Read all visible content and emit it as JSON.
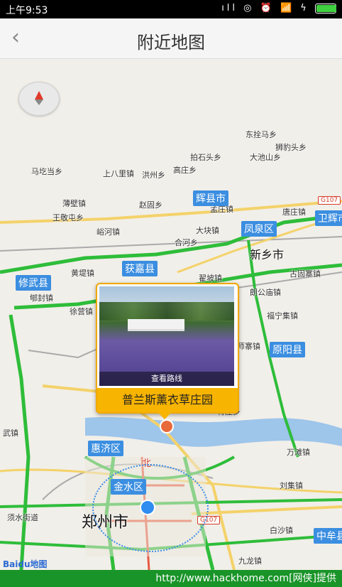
{
  "status": {
    "time": "上午9:53",
    "icons_text": "ıll ◎ ⏰ 📶 ϟ",
    "battery_level": 1.0
  },
  "header": {
    "title": "附近地图"
  },
  "map": {
    "places": [
      {
        "name": "马圪当乡"
      },
      {
        "name": "上八里镇"
      },
      {
        "name": "洪州乡"
      },
      {
        "name": "高庄乡"
      },
      {
        "name": "拍石头乡"
      },
      {
        "name": "大池山乡"
      },
      {
        "name": "东拴马乡"
      },
      {
        "name": "狮豹头乡"
      },
      {
        "name": "薄壁镇"
      },
      {
        "name": "赵固乡"
      },
      {
        "name": "孟庄镇"
      },
      {
        "name": "唐庄镇"
      },
      {
        "name": "王敬屯乡"
      },
      {
        "name": "峪河镇"
      },
      {
        "name": "大块镇"
      },
      {
        "name": "合河乡"
      },
      {
        "name": "黄堤镇"
      },
      {
        "name": "翟坡镇"
      },
      {
        "name": "古固寨镇"
      },
      {
        "name": "郇封镇"
      },
      {
        "name": "朗公庙镇"
      },
      {
        "name": "徐营镇"
      },
      {
        "name": "福宁集镇"
      },
      {
        "name": "师寨镇"
      },
      {
        "name": "武镇"
      },
      {
        "name": "将庄乡"
      },
      {
        "name": "万滩镇"
      },
      {
        "name": "刘集镇"
      },
      {
        "name": "须水街道"
      },
      {
        "name": "白沙镇"
      },
      {
        "name": "九龙镇"
      }
    ],
    "cities": {
      "xinxiang": "新乡市",
      "zhengzhou": "郑州市"
    },
    "districts": [
      {
        "name": "辉县市"
      },
      {
        "name": "凤泉区"
      },
      {
        "name": "卫辉市"
      },
      {
        "name": "获嘉县"
      },
      {
        "name": "修武县"
      },
      {
        "name": "原阳县"
      },
      {
        "name": "惠济区"
      },
      {
        "name": "金水区"
      },
      {
        "name": "中牟县"
      }
    ],
    "road_tags": [
      "G107",
      "G107"
    ],
    "north_label": "北",
    "popup": {
      "title": "普兰斯薰衣草庄园",
      "route_label": "查看路线"
    },
    "baidu": {
      "bai": "Bai",
      "du": "du",
      "map": "地图"
    }
  },
  "footer": {
    "watermark": "http://www.hackhome.com[网侠]提供"
  },
  "colors": {
    "accent": "#f7b400",
    "road_green": "#2ebd3a",
    "city_blue": "#3b8ee0"
  }
}
